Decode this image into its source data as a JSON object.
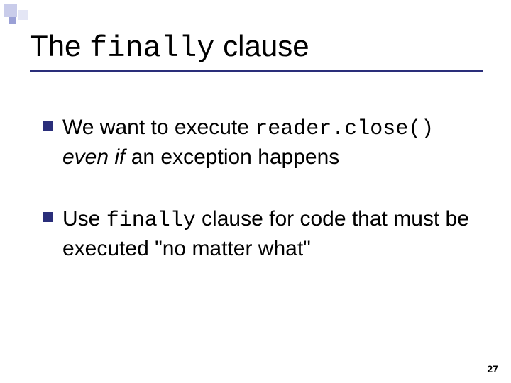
{
  "title": {
    "pre": "The ",
    "mono": "finally",
    "post": " clause"
  },
  "bullets": [
    {
      "pre": "We want to execute ",
      "mono": "reader.close()",
      "line2_ital": "even if",
      "line2_rest": " an exception happens"
    },
    {
      "pre": "Use ",
      "mono": "finally",
      "post": " clause for code that must be executed \"no matter what\""
    }
  ],
  "page_number": "27"
}
